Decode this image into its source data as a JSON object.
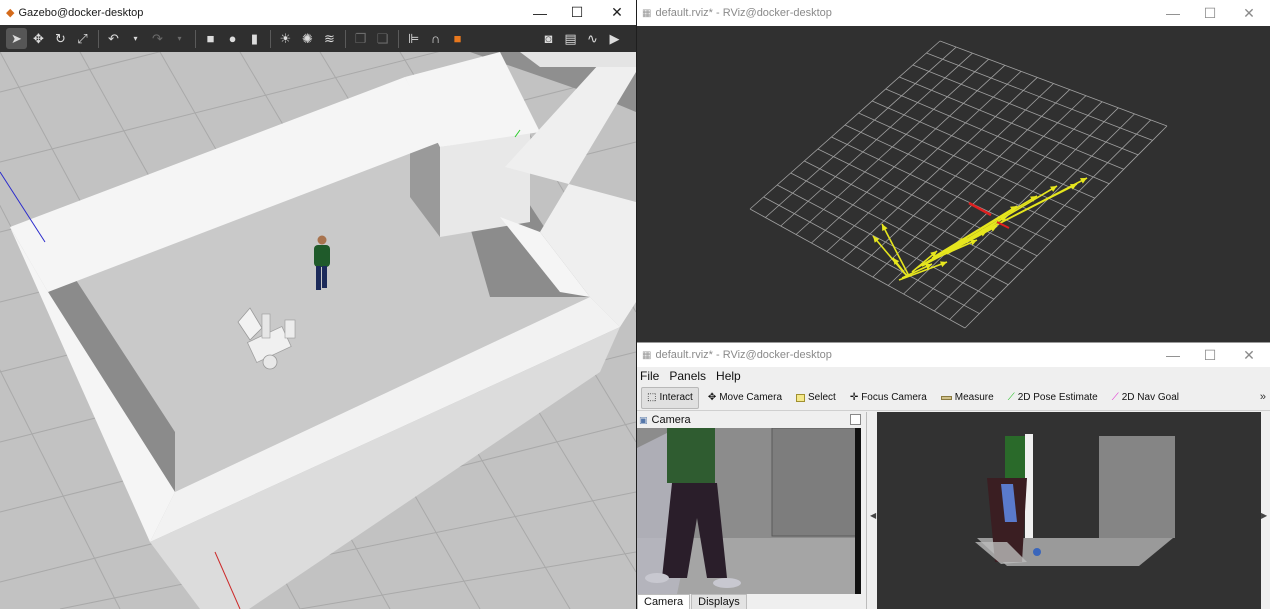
{
  "gazebo": {
    "title": "Gazebo@docker-desktop",
    "window_controls": {
      "minimize": "—",
      "maximize": "☐",
      "close": "✕"
    },
    "toolbar_icons": [
      "select-arrow-icon",
      "translate-icon",
      "rotate-icon",
      "scale-icon",
      "undo-icon",
      "undo-history-icon",
      "redo-icon",
      "redo-history-icon",
      "box-icon",
      "sphere-icon",
      "cylinder-icon",
      "point-light-icon",
      "spot-light-icon",
      "directional-light-icon",
      "copy-icon",
      "paste-icon",
      "align-icon",
      "snap-icon",
      "change-view-icon",
      "screenshot-icon",
      "log-icon",
      "plot-icon",
      "video-icon"
    ]
  },
  "rviz_top": {
    "title": "default.rviz* - RViz@docker-desktop",
    "window_controls": {
      "minimize": "—",
      "maximize": "☐",
      "close": "✕"
    }
  },
  "rviz_bottom": {
    "title": "default.rviz* - RViz@docker-desktop",
    "window_controls": {
      "minimize": "—",
      "maximize": "☐",
      "close": "✕"
    },
    "menu": [
      "File",
      "Panels",
      "Help"
    ],
    "tools": [
      {
        "label": "Interact",
        "icon": "cursor-icon",
        "active": true
      },
      {
        "label": "Move Camera",
        "icon": "move-icon",
        "active": false
      },
      {
        "label": "Select",
        "icon": "select-icon",
        "active": false
      },
      {
        "label": "Focus Camera",
        "icon": "focus-icon",
        "active": false
      },
      {
        "label": "Measure",
        "icon": "ruler-icon",
        "active": false
      },
      {
        "label": "2D Pose Estimate",
        "icon": "green-arrow-icon",
        "active": false,
        "color": "#22c022"
      },
      {
        "label": "2D Nav Goal",
        "icon": "pink-arrow-icon",
        "active": false,
        "color": "#e02ad0"
      }
    ],
    "overflow": "»",
    "camera_panel": {
      "title": "Camera",
      "tabs": [
        "Camera",
        "Displays"
      ]
    }
  },
  "colors": {
    "pose_array": "#e6e61e",
    "robot_heading": "#e02020",
    "grid": "#a0a0a0",
    "rviz_bg": "#303030"
  }
}
